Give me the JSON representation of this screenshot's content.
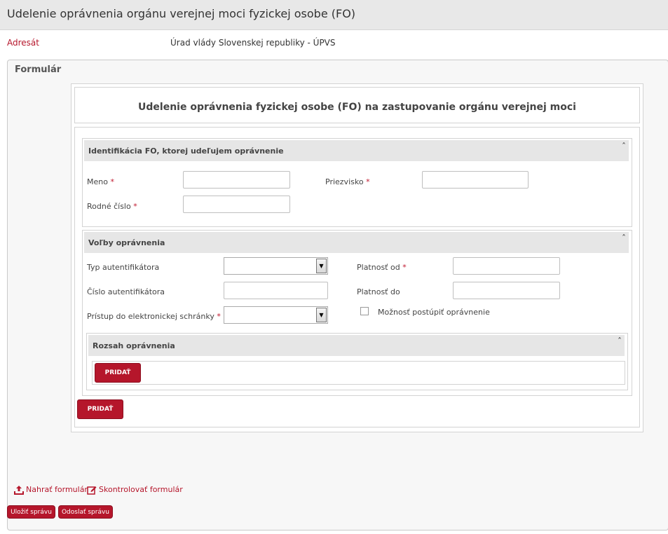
{
  "page": {
    "title": "Udelenie oprávnenia orgánu verejnej moci fyzickej osobe (FO)"
  },
  "recipient": {
    "label": "Adresát",
    "value": "Úrad vlády Slovenskej republiky - ÚPVS"
  },
  "form": {
    "legend": "Formulár",
    "heading": "Udelenie oprávnenia fyzickej osobe (FO) na zastupovanie orgánu verejnej moci",
    "identification": {
      "title": "Identifikácia FO, ktorej udeľujem oprávnenie",
      "collapse": "ˆ",
      "first_name_label": "Meno",
      "last_name_label": "Priezvisko",
      "birth_number_label": "Rodné číslo",
      "required_mark": "*",
      "first_name_value": "",
      "last_name_value": "",
      "birth_number_value": ""
    },
    "options": {
      "title": "Voľby oprávnenia",
      "collapse": "ˆ",
      "auth_type_label": "Typ autentifikátora",
      "auth_number_label": "Číslo autentifikátora",
      "mailbox_access_label": "Prístup do elektronickej schránky",
      "valid_from_label": "Platnosť od",
      "valid_to_label": "Platnosť do",
      "delegate_label": "Možnosť postúpiť oprávnenie",
      "required_mark": "*",
      "auth_type_value": "",
      "auth_number_value": "",
      "mailbox_access_value": "",
      "valid_from_value": "",
      "valid_to_value": "",
      "delegate_checked": false
    },
    "scope": {
      "title": "Rozsah oprávnenia",
      "collapse": "ˆ",
      "add_label": "PRIDAŤ"
    },
    "add_label": "PRIDAŤ"
  },
  "actions": {
    "upload_label": "Nahrať formulár",
    "validate_label": "Skontrolovať formulár",
    "save_label": "Uložiť správu",
    "send_label": "Odoslať správu"
  },
  "colors": {
    "accent": "#b5162b",
    "header_bg": "#e8e8e8"
  }
}
